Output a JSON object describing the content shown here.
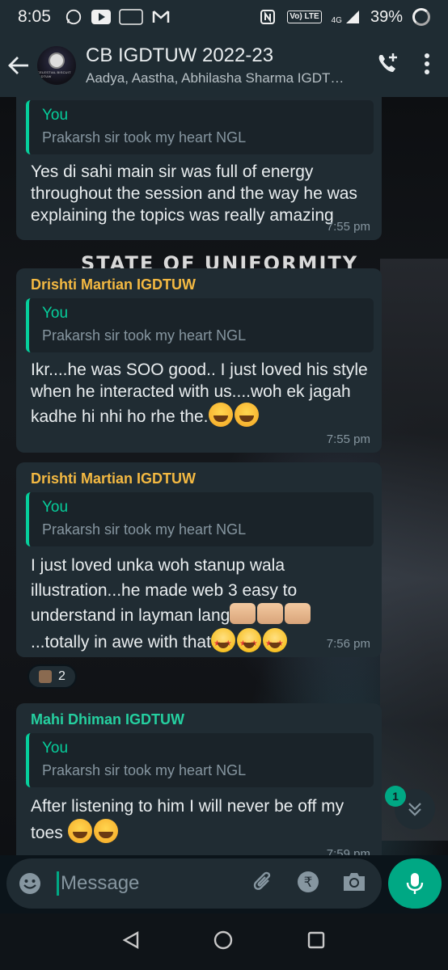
{
  "status_bar": {
    "time": "8:05",
    "app_icons": [
      "whatsapp-icon",
      "youtube-icon",
      "zomato-icon",
      "gmail-icon"
    ],
    "zomato_label": "zomato",
    "network_label": "Vo) LTE",
    "signal_label": "4G",
    "battery": "39%"
  },
  "header": {
    "title": "CB IGDTUW 2022-23",
    "subtitle": "Aadya, Aastha, Abhilasha Sharma IGDTUW",
    "avatar_text": "CELESTIAL BISCUIT IGDTUW"
  },
  "wallpaper": {
    "text": "STATE OF UNIFORMITY"
  },
  "messages": [
    {
      "sender": "",
      "quote_author": "You",
      "quote_text": "Prakarsh sir took my heart NGL",
      "body": "Yes di sahi main sir was full of energy throughout the session and the way he was explaining the topics was really amazing",
      "time": "7:55 pm"
    },
    {
      "sender": "Drishti Martian IGDTUW",
      "sender_color": "#f4b942",
      "quote_author": "You",
      "quote_text": "Prakarsh sir took my heart NGL",
      "body": "Ikr....he was SOO good.. I just loved his style when he interacted with us....woh ek jagah kadhe hi nhi ho rhe the.",
      "emojis": [
        "joy-emoji",
        "joy-emoji"
      ],
      "time": "7:55 pm"
    },
    {
      "sender": "Drishti Martian IGDTUW",
      "sender_color": "#f4b942",
      "quote_author": "You",
      "quote_text": "Prakarsh sir took my heart NGL",
      "body_part1": "I just loved unka woh stanup wala illustration...he made web 3 easy to understand in layman lang",
      "body_part2": "...totally in awe with that",
      "emojis_hands": [
        "raised-hands-emoji",
        "raised-hands-emoji",
        "raised-hands-emoji"
      ],
      "emojis_star": [
        "star-struck-emoji",
        "star-struck-emoji",
        "star-struck-emoji"
      ],
      "time": "7:56 pm",
      "reaction_count": "2"
    },
    {
      "sender": "Mahi Dhiman IGDTUW",
      "sender_color": "#25d0a0",
      "quote_author": "You",
      "quote_text": "Prakarsh sir took my heart NGL",
      "body": "After listening to him I will never be off my toes",
      "emojis": [
        "joy-emoji",
        "joy-emoji"
      ],
      "time": "7:59 pm"
    }
  ],
  "scroll": {
    "unread_count": "1"
  },
  "composer": {
    "placeholder": "Message"
  },
  "colors": {
    "accent": "#00a884",
    "bubble": "#202c33",
    "header": "#1f2c33"
  }
}
